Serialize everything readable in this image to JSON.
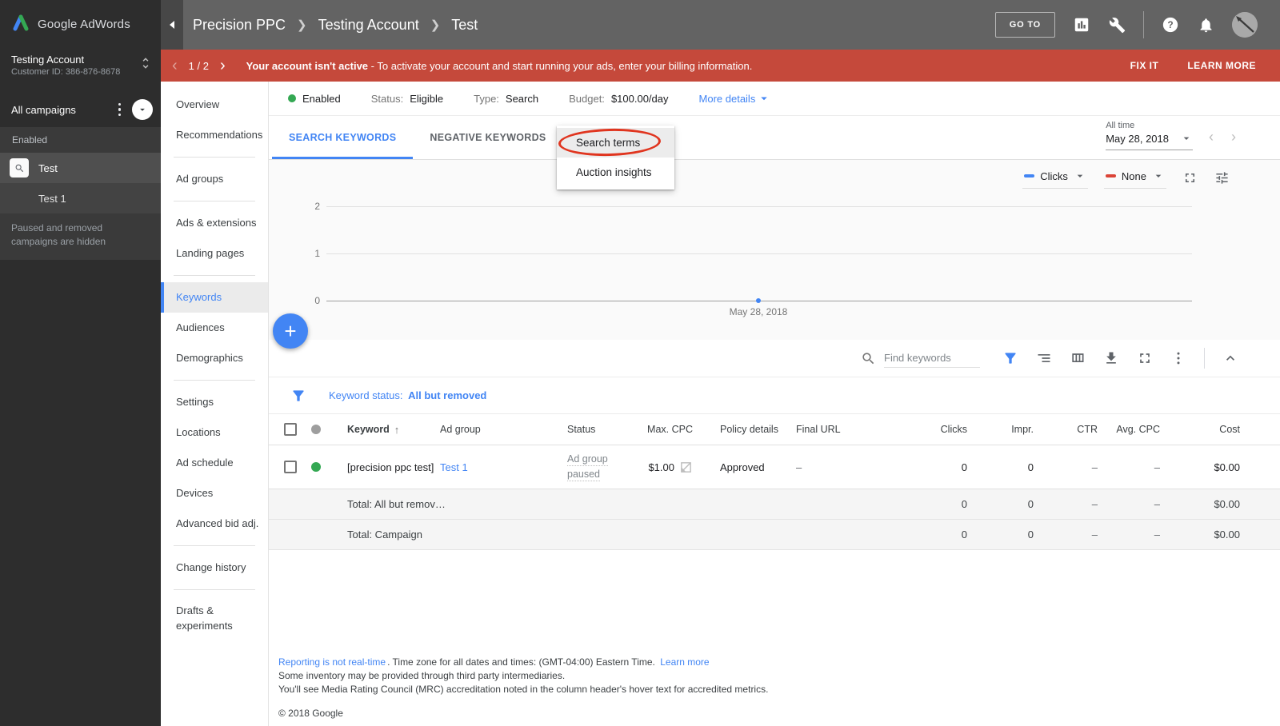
{
  "colors": {
    "accent_blue": "#4285f4",
    "banner_red": "#c5493b",
    "enabled_green": "#34a853",
    "series_red": "#db4437"
  },
  "sidebar": {
    "brand": "Google AdWords",
    "account_name": "Testing Account",
    "customer_id": "Customer ID: 386-876-8678",
    "all_campaigns": "All campaigns",
    "group_label": "Enabled",
    "campaigns": [
      {
        "name": "Test",
        "selected": true
      },
      {
        "name": "Test 1",
        "selected": false
      }
    ],
    "note": "Paused and removed campaigns are hidden"
  },
  "header": {
    "breadcrumb": [
      "Precision PPC",
      "Testing Account",
      "Test"
    ],
    "go_to": "GO TO"
  },
  "alert": {
    "pager": "1 / 2",
    "bold": "Your account isn't active",
    "rest": "- To activate your account and start running your ads, enter your billing information.",
    "fix": "FIX IT",
    "learn": "LEARN MORE"
  },
  "subnav": {
    "items": [
      {
        "label": "Overview"
      },
      {
        "label": "Recommendations",
        "divider_after": true
      },
      {
        "label": "Ad groups",
        "divider_after": true
      },
      {
        "label": "Ads & extensions"
      },
      {
        "label": "Landing pages",
        "divider_after": true
      },
      {
        "label": "Keywords",
        "selected": true
      },
      {
        "label": "Audiences"
      },
      {
        "label": "Demographics",
        "divider_after": true
      },
      {
        "label": "Settings"
      },
      {
        "label": "Locations"
      },
      {
        "label": "Ad schedule"
      },
      {
        "label": "Devices"
      },
      {
        "label": "Advanced bid adj.",
        "divider_after": true
      },
      {
        "label": "Change history",
        "divider_after": true
      },
      {
        "label": "Drafts & experiments",
        "wrap": true
      }
    ]
  },
  "status_bar": {
    "state": "Enabled",
    "status_label": "Status:",
    "status_value": "Eligible",
    "type_label": "Type:",
    "type_value": "Search",
    "budget_label": "Budget:",
    "budget_value": "$100.00/day",
    "more_details": "More details"
  },
  "tabs": [
    {
      "label": "SEARCH KEYWORDS",
      "active": true
    },
    {
      "label": "NEGATIVE KEYWORDS",
      "active": false
    }
  ],
  "dropdown": {
    "items": [
      "Search terms",
      "Auction insights"
    ],
    "highlighted": "Search terms"
  },
  "date_range": {
    "preset": "All time",
    "value": "May 28, 2018"
  },
  "chart_data": {
    "type": "line",
    "x": [
      "May 28, 2018"
    ],
    "series": [
      {
        "name": "Clicks",
        "values": [
          0
        ],
        "color": "#4285f4"
      },
      {
        "name": "None",
        "values": [],
        "color": "#db4437"
      }
    ],
    "yticks": [
      0,
      1,
      2
    ],
    "ylim": [
      0,
      2
    ],
    "grid": true,
    "legend_position": "top-right",
    "title": "",
    "xlabel": "",
    "ylabel": ""
  },
  "toolbar": {
    "search_placeholder": "Find keywords"
  },
  "filter": {
    "prefix": "Keyword status:",
    "value": "All but removed"
  },
  "table": {
    "columns": {
      "keyword": "Keyword",
      "ad_group": "Ad group",
      "status": "Status",
      "max_cpc": "Max. CPC",
      "policy": "Policy details",
      "final_url": "Final URL",
      "clicks": "Clicks",
      "impr": "Impr.",
      "ctr": "CTR",
      "avg_cpc": "Avg. CPC",
      "cost": "Cost"
    },
    "row": {
      "keyword": "[precision ppc test]",
      "ad_group": "Test 1",
      "status_line1": "Ad group",
      "status_line2": "paused",
      "max_cpc": "$1.00",
      "policy": "Approved",
      "final_url": "–",
      "clicks": "0",
      "impr": "0",
      "ctr": "–",
      "avg_cpc": "–",
      "cost": "$0.00"
    },
    "totals": [
      {
        "label": "Total: All but remov…",
        "clicks": "0",
        "impr": "0",
        "ctr": "–",
        "avg_cpc": "–",
        "cost": "$0.00"
      },
      {
        "label": "Total: Campaign",
        "clicks": "0",
        "impr": "0",
        "ctr": "–",
        "avg_cpc": "–",
        "cost": "$0.00"
      }
    ]
  },
  "footer": {
    "link1": "Reporting is not real-time",
    "line1_rest": ". Time zone for all dates and times: (GMT-04:00) Eastern Time.",
    "link2": "Learn more",
    "line2": "Some inventory may be provided through third party intermediaries.",
    "line3": "You'll see Media Rating Council (MRC) accreditation noted in the column header's hover text for accredited metrics.",
    "copyright": "© 2018 Google"
  }
}
